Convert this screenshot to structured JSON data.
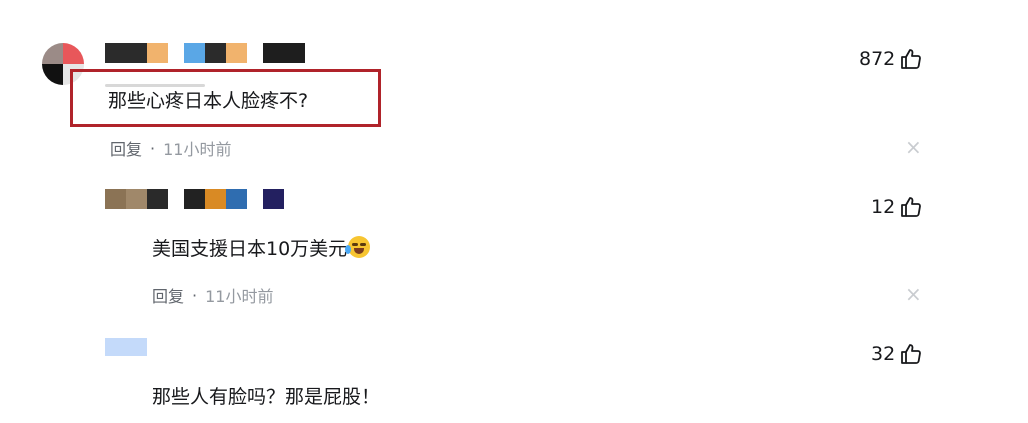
{
  "comments": [
    {
      "text": "那些心疼日本人脸疼不?",
      "reply_label": "回复",
      "separator": "·",
      "time": "11小时前",
      "likes": "872",
      "close_symbol": "×"
    },
    {
      "text": "美国支援日本10万美元",
      "emoji": "crying-laughing-emoji",
      "reply_label": "回复",
      "separator": "·",
      "time": "11小时前",
      "likes": "12",
      "close_symbol": "×"
    },
    {
      "text": "那些人有脸吗？那是屁股！",
      "likes": "32"
    }
  ],
  "colors": {
    "highlight_border": "#b0232a",
    "meta_text": "#61666d",
    "time_text": "#9499a0",
    "close_icon": "#c9ccd0"
  },
  "icons": {
    "like": "thumbs-up-icon",
    "close": "close-icon"
  }
}
